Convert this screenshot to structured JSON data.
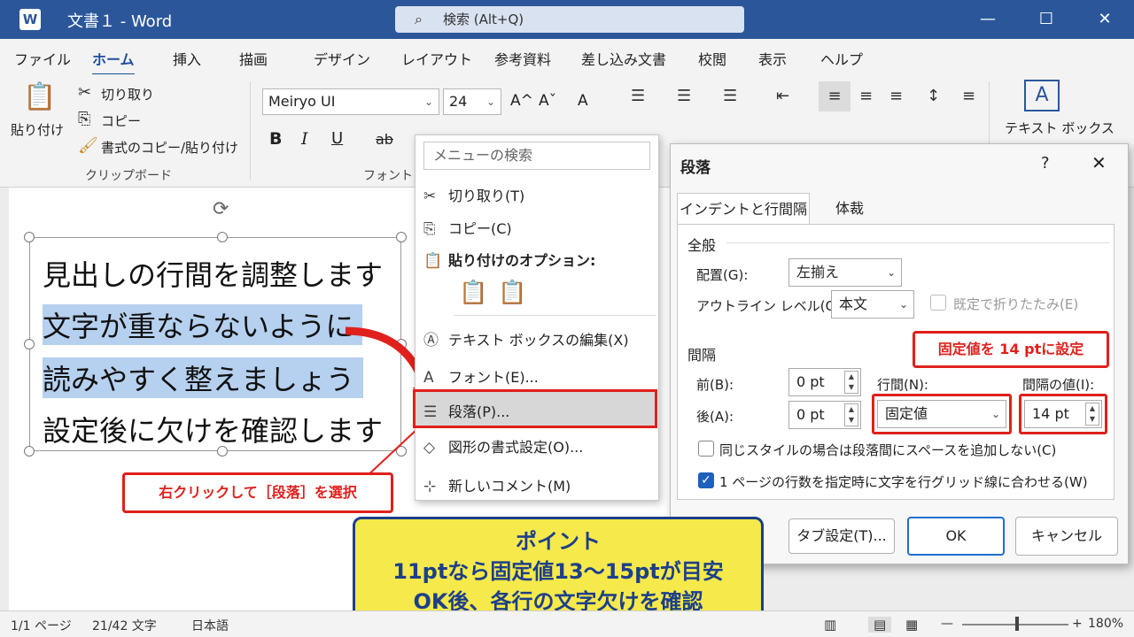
{
  "app": {
    "logo": "W",
    "title": "文書１ - Word",
    "search": "検索 (Alt+Q)",
    "window_buttons": [
      "—",
      "☐",
      "✕"
    ]
  },
  "menu_tabs": [
    "ファイル",
    "ホーム",
    "挿入",
    "描画",
    "デザイン",
    "レイアウト",
    "参考資料",
    "差し込み文書",
    "校閲",
    "表示",
    "ヘルプ"
  ],
  "ribbon": {
    "clipboard": {
      "paste": "貼り付け",
      "cut": "切り取り",
      "copy": "コピー",
      "format_painter": "書式のコピー/貼り付け",
      "label": "クリップボード"
    },
    "font": {
      "name": "Meiryo UI",
      "size": "24",
      "label": "フォント",
      "bold": "B",
      "italic": "I",
      "underline": "U",
      "strike": "ab",
      "grow": "A^",
      "shrink": "Aˇ",
      "clear": "A"
    },
    "textbox": "テキスト ボックス",
    "textbox_icon": "A"
  },
  "document": {
    "lines": [
      "見出しの行間を調整します",
      "文字が重ならないように",
      "読みやすく整えましょう",
      "設定後に欠けを確認します"
    ]
  },
  "context_menu": {
    "search_placeholder": "メニューの検索",
    "cut": "切り取り(T)",
    "copy": "コピー(C)",
    "paste_options": "貼り付けのオプション:",
    "edit_textbox": "テキスト ボックスの編集(X)",
    "font": "フォント(E)...",
    "paragraph": "段落(P)...",
    "shape_format": "図形の書式設定(O)...",
    "new_comment": "新しいコメント(M)"
  },
  "dialog": {
    "title": "段落",
    "help": "?",
    "close": "✕",
    "tabs": [
      "インデントと行間隔",
      "体裁"
    ],
    "general": "全般",
    "alignment_label": "配置(G):",
    "alignment_value": "左揃え",
    "outline_label": "アウトライン レベル(O):",
    "outline_value": "本文",
    "collapsed_label": "既定で折りたたみ(E)",
    "spacing": "間隔",
    "before_label": "前(B):",
    "before_value": "0 pt",
    "after_label": "後(A):",
    "after_value": "0 pt",
    "line_spacing_label": "行間(N):",
    "line_spacing_value": "固定値",
    "at_label": "間隔の値(I):",
    "at_value": "14 pt",
    "no_space_label": "同じスタイルの場合は段落間にスペースを追加しない(C)",
    "grid_label": "1 ページの行数を指定時に文字を行グリッド線に合わせる(W)",
    "tabs_button": "タブ設定(T)...",
    "ok": "OK",
    "cancel": "キャンセル"
  },
  "callouts": {
    "right_click": "右クリックして［段落］を選択",
    "fixed_value": "固定値を 14 ptに設定",
    "point_title": "ポイント",
    "point_line1": "11ptなら固定値13～15ptが目安",
    "point_line2": "OK後、各行の文字欠けを確認"
  },
  "status": {
    "page": "1/1 ページ",
    "words": "21/42 文字",
    "language": "日本語",
    "zoom": "180%"
  }
}
